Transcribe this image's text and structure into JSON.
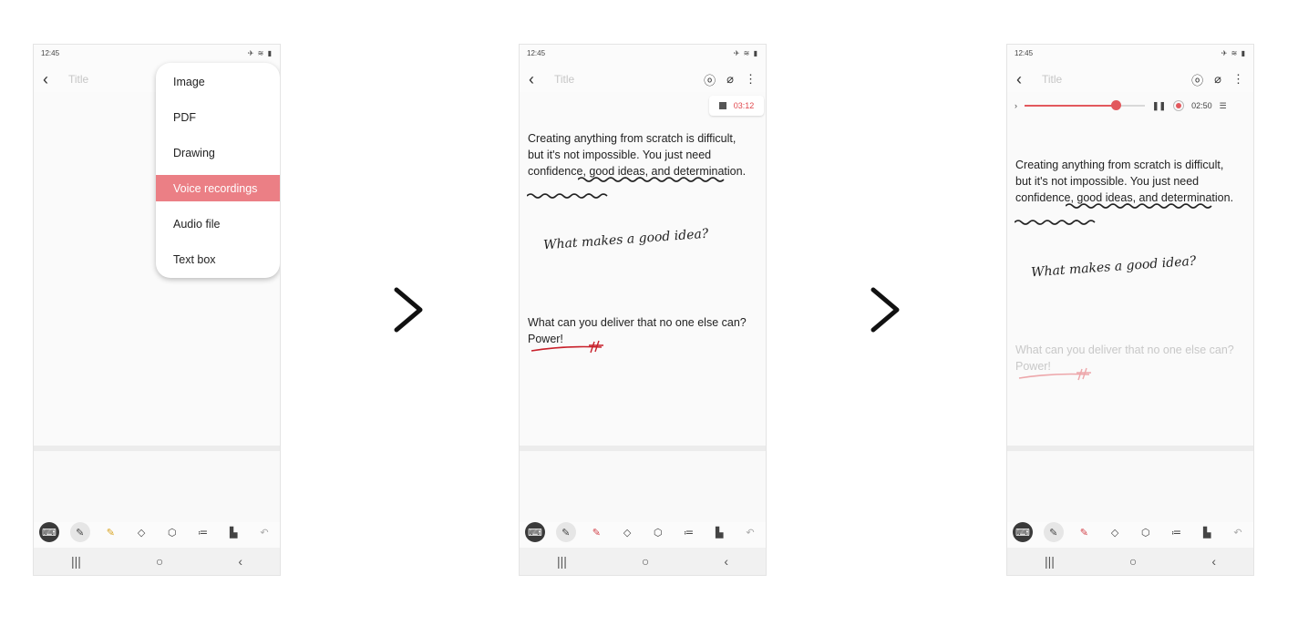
{
  "colors": {
    "accent": "#e2585d",
    "highlight": "#eb7f85"
  },
  "screens": [
    {
      "status": {
        "time": "12:45",
        "icons": "signal-wifi-battery"
      },
      "title_placeholder": "Title",
      "menu": [
        {
          "label": "Image"
        },
        {
          "label": "PDF"
        },
        {
          "label": "Drawing"
        },
        {
          "label": "Voice recordings",
          "highlighted": true
        },
        {
          "label": "Audio file"
        },
        {
          "label": "Text box"
        }
      ]
    },
    {
      "status": {
        "time": "12:45"
      },
      "title_placeholder": "Title",
      "recording_time": "03:12",
      "paragraph1": "Creating anything from scratch is difficult, but it's not impossible. You just need confidence, good ideas, and determination.",
      "handwriting": "What makes a good idea?",
      "paragraph2": "What can you deliver that no one else can? Power!"
    },
    {
      "status": {
        "time": "12:45"
      },
      "title_placeholder": "Title",
      "playback_time": "02:50",
      "playback_progress": 0.76,
      "paragraph1": "Creating anything from scratch is difficult, but it's not impossible. You just need confidence, good ideas, and determination.",
      "handwriting": "What makes a good idea?",
      "paragraph2": "What can you deliver that no one else can? Power!"
    }
  ],
  "toolbar_icons": [
    "keyboard-icon",
    "pen-icon",
    "highlighter-icon",
    "eraser-icon",
    "lasso-icon",
    "text-style-icon",
    "insert-icon",
    "undo-icon"
  ],
  "navbar_icons": [
    "recents-icon",
    "home-icon",
    "back-icon"
  ]
}
